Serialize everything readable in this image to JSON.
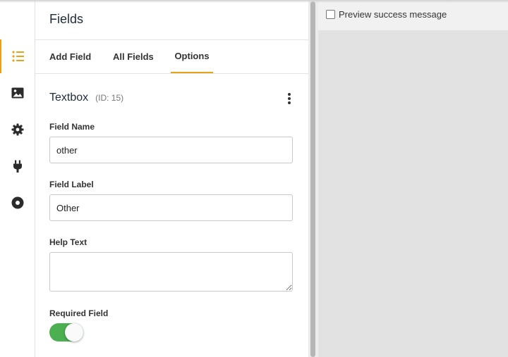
{
  "sidebar": {
    "items": [
      {
        "icon": "list-icon",
        "active": true
      },
      {
        "icon": "image-icon",
        "active": false
      },
      {
        "icon": "gear-icon",
        "active": false
      },
      {
        "icon": "plug-icon",
        "active": false
      },
      {
        "icon": "target-icon",
        "active": false
      }
    ],
    "accent_color": "#e8a21a"
  },
  "panel": {
    "title": "Fields",
    "tabs": [
      {
        "label": "Add Field",
        "active": false
      },
      {
        "label": "All Fields",
        "active": false
      },
      {
        "label": "Options",
        "active": true
      }
    ],
    "field": {
      "type": "Textbox",
      "id_label": "(ID: 15)"
    },
    "form": {
      "field_name_label": "Field Name",
      "field_name_value": "other",
      "field_label_label": "Field Label",
      "field_label_value": "Other",
      "help_text_label": "Help Text",
      "help_text_value": "",
      "required_label": "Required Field",
      "required_on": true,
      "toggle_color": "#4caf50"
    }
  },
  "preview": {
    "checkbox_label": "Preview success message",
    "checked": false
  }
}
